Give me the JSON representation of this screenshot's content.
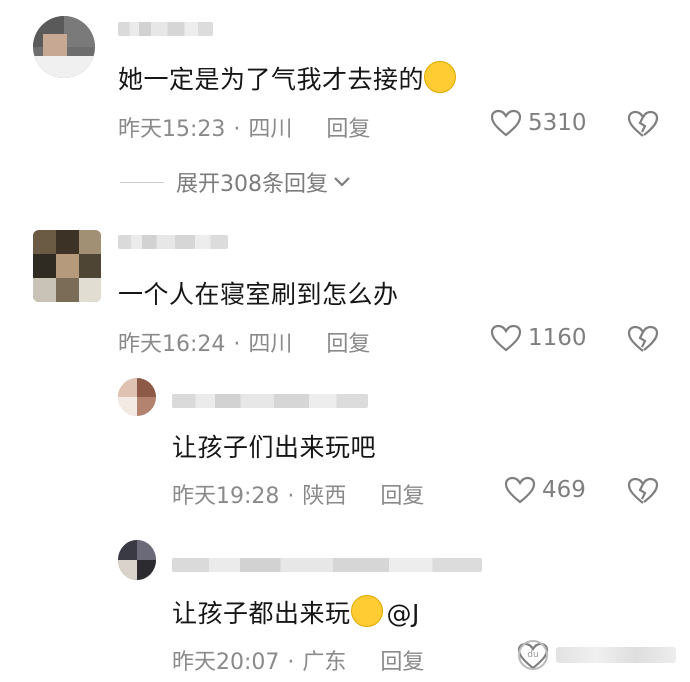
{
  "comments": [
    {
      "content": "她一定是为了气我才去接的",
      "emoji": "crying-face-emoji",
      "time": "昨天15:23",
      "location": "四川",
      "reply_label": "回复",
      "likes": "5310",
      "expand_label": "展开308条回复"
    },
    {
      "content": "一个人在寝室刷到怎么办",
      "time": "昨天16:24",
      "location": "四川",
      "reply_label": "回复",
      "likes": "1160"
    },
    {
      "content": "让孩子们出来玩吧",
      "time": "昨天19:28",
      "location": "陕西",
      "reply_label": "回复",
      "likes": "469"
    },
    {
      "content": "让孩子都出来玩",
      "emoji": "rolling-laughing-emoji",
      "mention": "@J",
      "time": "昨天20:07",
      "location": "广东",
      "reply_label": "回复"
    }
  ],
  "icons": {
    "like": "heart-outline-icon",
    "dislike": "broken-heart-icon",
    "expand": "chevron-down-icon"
  },
  "colors": {
    "text_primary": "#161616",
    "text_secondary": "#8a8a8a",
    "emoji_yellow": "#ffcc33"
  }
}
